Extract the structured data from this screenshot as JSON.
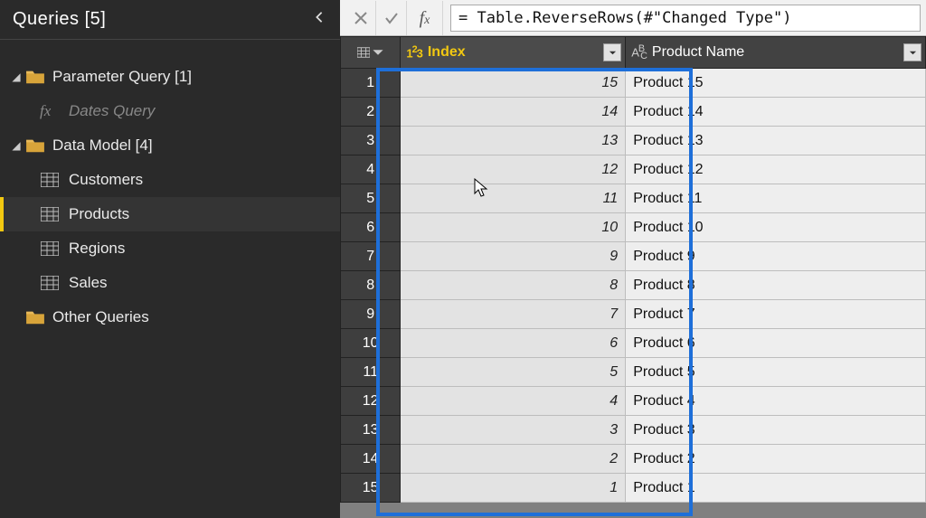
{
  "sidebar": {
    "title": "Queries [5]",
    "groups": [
      {
        "label": "Parameter Query [1]",
        "children": [
          {
            "label": "Dates Query",
            "type": "fx"
          }
        ]
      },
      {
        "label": "Data Model [4]",
        "children": [
          {
            "label": "Customers",
            "type": "table"
          },
          {
            "label": "Products",
            "type": "table",
            "selected": true
          },
          {
            "label": "Regions",
            "type": "table"
          },
          {
            "label": "Sales",
            "type": "table"
          }
        ]
      },
      {
        "label": "Other Queries",
        "children": []
      }
    ]
  },
  "formula": {
    "value": "= Table.ReverseRows(#\"Changed Type\")"
  },
  "columns": {
    "index": "Index",
    "name": "Product Name"
  },
  "rows": [
    {
      "n": 1,
      "index": 15,
      "name": "Product 15"
    },
    {
      "n": 2,
      "index": 14,
      "name": "Product 14"
    },
    {
      "n": 3,
      "index": 13,
      "name": "Product 13"
    },
    {
      "n": 4,
      "index": 12,
      "name": "Product 12"
    },
    {
      "n": 5,
      "index": 11,
      "name": "Product 11"
    },
    {
      "n": 6,
      "index": 10,
      "name": "Product 10"
    },
    {
      "n": 7,
      "index": 9,
      "name": "Product 9"
    },
    {
      "n": 8,
      "index": 8,
      "name": "Product 8"
    },
    {
      "n": 9,
      "index": 7,
      "name": "Product 7"
    },
    {
      "n": 10,
      "index": 6,
      "name": "Product 6"
    },
    {
      "n": 11,
      "index": 5,
      "name": "Product 5"
    },
    {
      "n": 12,
      "index": 4,
      "name": "Product 4"
    },
    {
      "n": 13,
      "index": 3,
      "name": "Product 3"
    },
    {
      "n": 14,
      "index": 2,
      "name": "Product 2"
    },
    {
      "n": 15,
      "index": 1,
      "name": "Product 1"
    }
  ]
}
